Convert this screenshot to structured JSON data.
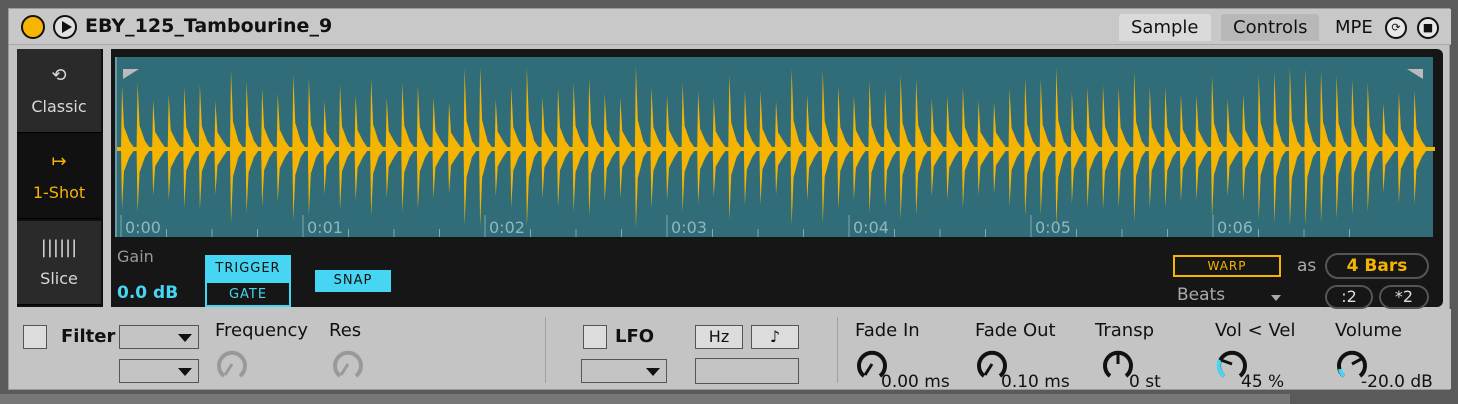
{
  "device": {
    "title": "EBY_125_Tambourine_9",
    "tabs": [
      "Sample",
      "Controls"
    ],
    "mpe_label": "MPE"
  },
  "modes": [
    {
      "label": "Classic",
      "icon": "loop-icon",
      "active": false
    },
    {
      "label": "1-Shot",
      "icon": "oneshot-arrow-icon",
      "active": true
    },
    {
      "label": "Slice",
      "icon": "slice-bars-icon",
      "active": false
    }
  ],
  "waveform": {
    "time_labels": [
      "0:00",
      "0:01",
      "0:02",
      "0:03",
      "0:04",
      "0:05",
      "0:06"
    ],
    "wave_color": "#f4b400",
    "background_color": "#316d79"
  },
  "sample_controls": {
    "gain_label": "Gain",
    "gain_value": "0.0 dB",
    "trigger_label": "TRIGGER",
    "gate_label": "GATE",
    "snap_label": "SNAP",
    "warp_label": "WARP",
    "as_label": "as",
    "bars_value": "4 Bars",
    "warp_mode": "Beats",
    "half_label": ":2",
    "double_label": "*2",
    "accent_color": "#46d5f2"
  },
  "filter": {
    "label": "Filter",
    "frequency_label": "Frequency",
    "res_label": "Res"
  },
  "lfo": {
    "label": "LFO",
    "hz_label": "Hz",
    "note_label": "♪"
  },
  "envelope": {
    "fade_in_label": "Fade In",
    "fade_in_value": "0.00 ms",
    "fade_out_label": "Fade Out",
    "fade_out_value": "0.10 ms",
    "transp_label": "Transp",
    "transp_value": "0 st",
    "vol_vel_label": "Vol < Vel",
    "vol_vel_value": "45 %",
    "volume_label": "Volume",
    "volume_value": "-20.0 dB"
  }
}
